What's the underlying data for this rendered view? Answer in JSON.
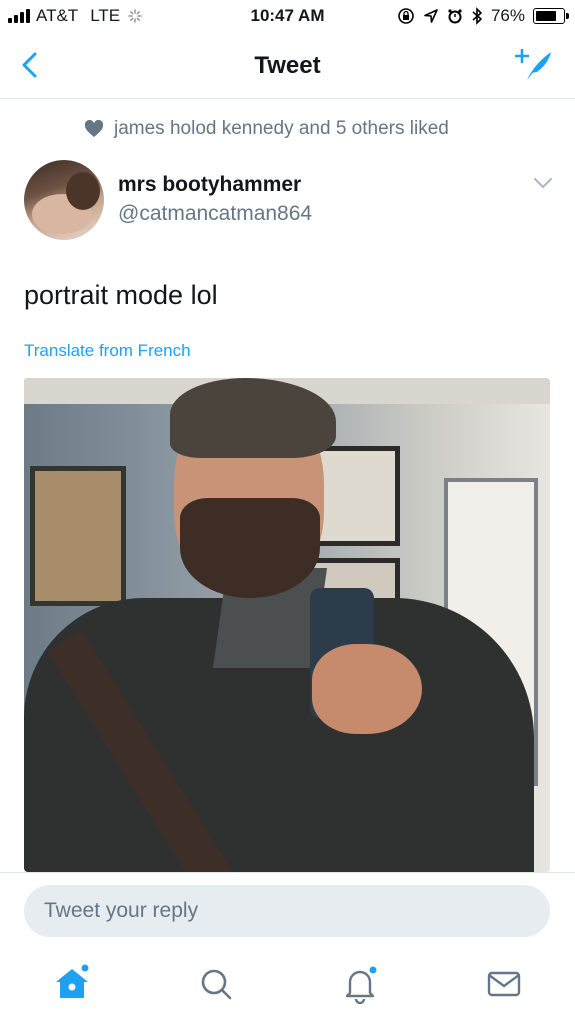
{
  "status_bar": {
    "carrier": "AT&T",
    "network": "LTE",
    "time": "10:47 AM",
    "battery": "76%",
    "battery_level": 0.76
  },
  "nav": {
    "title": "Tweet"
  },
  "social_context": "james holod kennedy and 5 others liked",
  "tweet": {
    "display_name": "mrs bootyhammer",
    "handle": "@catmancatman864",
    "text": "portrait mode lol",
    "translate_label": "Translate from French"
  },
  "reply": {
    "placeholder": "Tweet your reply"
  },
  "tabs": [
    {
      "icon": "home-icon",
      "active": true,
      "dot": true
    },
    {
      "icon": "search-icon",
      "active": false,
      "dot": false
    },
    {
      "icon": "notifications-icon",
      "active": false,
      "dot": true
    },
    {
      "icon": "messages-icon",
      "active": false,
      "dot": false
    }
  ],
  "colors": {
    "accent": "#1da1f2",
    "secondary_text": "#657786",
    "reply_box_bg": "#e6ecf0",
    "divider": "#e1e8ed"
  }
}
